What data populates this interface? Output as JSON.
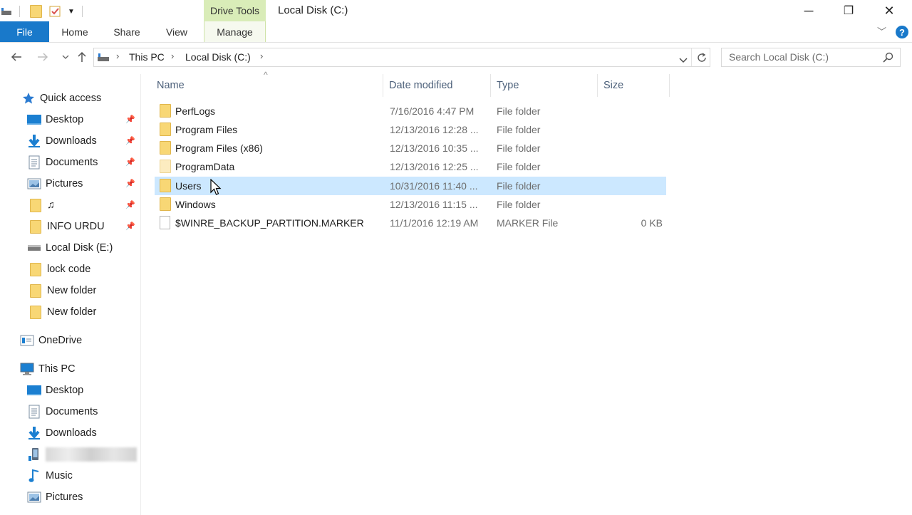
{
  "window": {
    "title": "Local Disk (C:)",
    "context_tab_group": "Drive Tools",
    "minimize": "─",
    "maximize": "❐",
    "close": "✕"
  },
  "ribbon": {
    "tabs": [
      {
        "label": "File"
      },
      {
        "label": "Home"
      },
      {
        "label": "Share"
      },
      {
        "label": "View"
      },
      {
        "label": "Manage"
      }
    ],
    "help": "?"
  },
  "address_bar": {
    "breadcrumb": [
      "This PC",
      "Local Disk (C:)"
    ],
    "search_placeholder": "Search Local Disk (C:)"
  },
  "nav_pane": {
    "quick_access": {
      "label": "Quick access",
      "items": [
        {
          "label": "Desktop",
          "icon": "desktop-icon",
          "pinned": true
        },
        {
          "label": "Downloads",
          "icon": "downloads-icon",
          "pinned": true
        },
        {
          "label": "Documents",
          "icon": "documents-icon",
          "pinned": true
        },
        {
          "label": "Pictures",
          "icon": "pictures-icon",
          "pinned": true
        },
        {
          "label": "♫",
          "icon": "folder-icon",
          "pinned": true
        },
        {
          "label": "INFO URDU",
          "icon": "folder-icon",
          "pinned": true
        },
        {
          "label": "Local Disk (E:)",
          "icon": "drive-icon",
          "pinned": false
        },
        {
          "label": "lock code",
          "icon": "folder-icon",
          "pinned": false
        },
        {
          "label": "New folder",
          "icon": "folder-icon",
          "pinned": false
        },
        {
          "label": "New folder",
          "icon": "folder-icon",
          "pinned": false
        }
      ]
    },
    "onedrive": {
      "label": "OneDrive"
    },
    "this_pc": {
      "label": "This PC",
      "items": [
        {
          "label": "Desktop",
          "icon": "desktop-icon"
        },
        {
          "label": "Documents",
          "icon": "documents-icon"
        },
        {
          "label": "Downloads",
          "icon": "downloads-icon"
        },
        {
          "label": "",
          "icon": "phone-icon"
        },
        {
          "label": "Music",
          "icon": "music-icon"
        },
        {
          "label": "Pictures",
          "icon": "pictures-icon"
        }
      ]
    }
  },
  "file_list": {
    "columns": [
      "Name",
      "Date modified",
      "Type",
      "Size"
    ],
    "sort_indicator": "^",
    "rows": [
      {
        "name": "PerfLogs",
        "date": "7/16/2016 4:47 PM",
        "type": "File folder",
        "size": "",
        "icon": "folder-icon"
      },
      {
        "name": "Program Files",
        "date": "12/13/2016 12:28 ...",
        "type": "File folder",
        "size": "",
        "icon": "folder-icon"
      },
      {
        "name": "Program Files (x86)",
        "date": "12/13/2016 10:35 ...",
        "type": "File folder",
        "size": "",
        "icon": "folder-icon"
      },
      {
        "name": "ProgramData",
        "date": "12/13/2016 12:25 ...",
        "type": "File folder",
        "size": "",
        "icon": "hidden-folder-icon"
      },
      {
        "name": "Users",
        "date": "10/31/2016 11:40 ...",
        "type": "File folder",
        "size": "",
        "icon": "folder-icon",
        "hovered": true
      },
      {
        "name": "Windows",
        "date": "12/13/2016 11:15 ...",
        "type": "File folder",
        "size": "",
        "icon": "folder-icon"
      },
      {
        "name": "$WINRE_BACKUP_PARTITION.MARKER",
        "date": "11/1/2016 12:19 AM",
        "type": "MARKER File",
        "size": "0 KB",
        "icon": "file-icon"
      }
    ]
  }
}
